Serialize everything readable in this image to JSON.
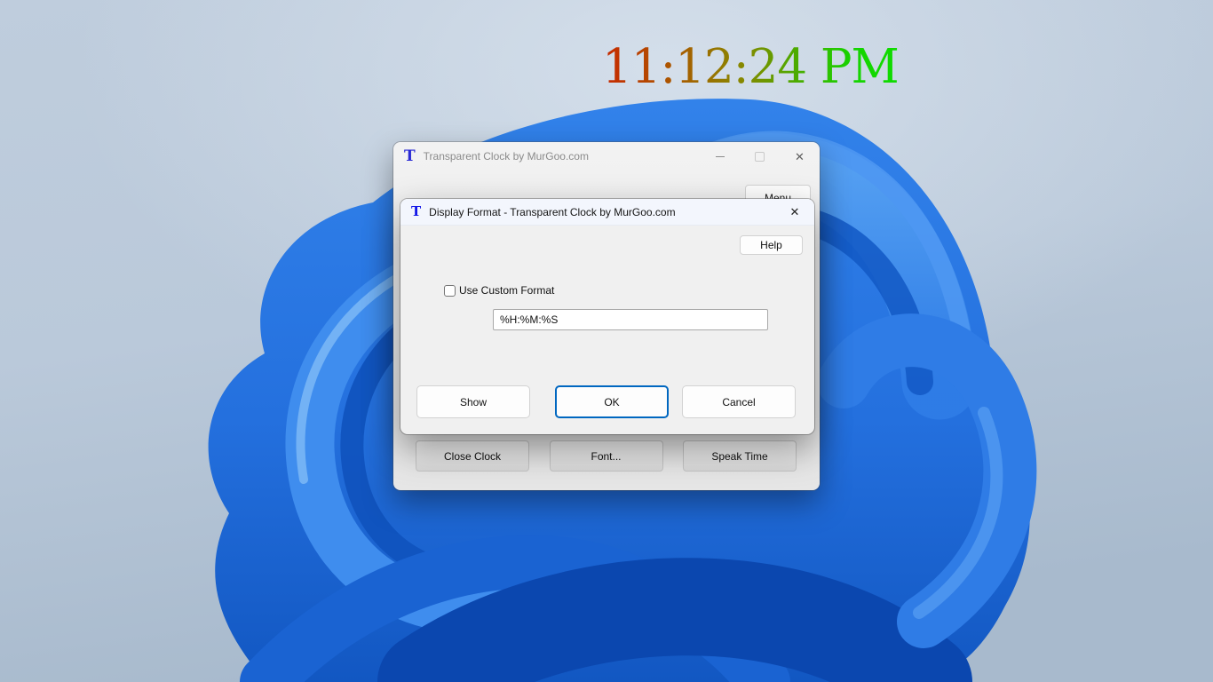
{
  "wallpaper": {
    "style": "windows-11-bloom",
    "bg_top": "#c4d2e0",
    "bg_bottom": "#a7b9cc",
    "bloom_blue": "#2e7ce6",
    "bloom_dark": "#0c49b0",
    "bloom_light": "#5fa3f0"
  },
  "clock_overlay": {
    "time_text": "11:12:24 PM",
    "gradient_colors": [
      "#c82800",
      "#a85c00",
      "#8a8600",
      "#4aac00",
      "#0fdc00"
    ]
  },
  "icons": {
    "minimize_glyph": "minimize-dash",
    "maximize_glyph": "maximize-square",
    "close_glyph": "✕"
  },
  "main_window": {
    "app_icon_letter": "T",
    "title": "Transparent Clock by MurGoo.com",
    "menu_button_label": "Menu",
    "footer_buttons": [
      "Close Clock",
      "Font...",
      "Speak Time"
    ]
  },
  "dialog": {
    "app_icon_letter": "T",
    "title": "Display Format - Transparent Clock by MurGoo.com",
    "help_button_label": "Help",
    "custom_format_checkbox": {
      "label": "Use Custom Format",
      "checked": false
    },
    "format_input": {
      "value": "%H:%M:%S"
    },
    "buttons": {
      "show": "Show",
      "ok": "OK",
      "cancel": "Cancel"
    },
    "accent_color": "#0067c0"
  }
}
